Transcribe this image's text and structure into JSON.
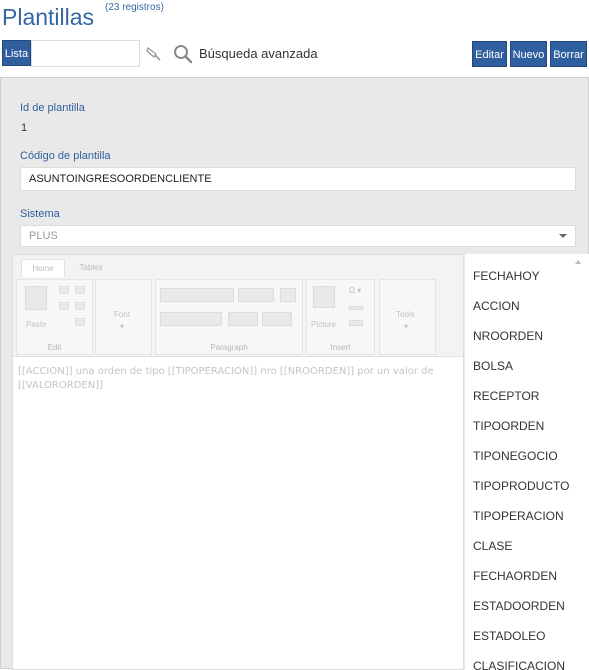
{
  "header": {
    "title": "Plantillas",
    "count": "(23 registros)"
  },
  "toolbar": {
    "list_label": "Lista",
    "search_value": "",
    "advanced_search": "Búsqueda avanzada",
    "edit_label": "Editar",
    "new_label": "Nuevo",
    "delete_label": "Borrar"
  },
  "form": {
    "id_label": "Id de plantilla",
    "id_value": "1",
    "code_label": "Código de plantilla",
    "code_value": "ASUNTOINGRESOORDENCLIENTE",
    "system_label": "Sistema",
    "system_value": "PLUS"
  },
  "editor": {
    "tabs": [
      "Home",
      "Tables"
    ],
    "groups": {
      "edit": "Edit",
      "paste": "Paste",
      "font": "Font",
      "paragraph": "Paragraph",
      "insert": "Insert",
      "picture": "Picture",
      "tools": "Tools"
    },
    "content": "[[ACCION]] una orden de tipo [[TIPOPERACION]] nro [[NROORDEN]] por un valor de [[VALORORDEN]]"
  },
  "variables": [
    "FECHAHOY",
    "ACCION",
    "NROORDEN",
    "BOLSA",
    "RECEPTOR",
    "TIPOORDEN",
    "TIPONEGOCIO",
    "TIPOPRODUCTO",
    "TIPOPERACION",
    "CLASE",
    "FECHAORDEN",
    "ESTADOORDEN",
    "ESTADOLEO",
    "CLASIFICACION"
  ],
  "colors": {
    "accent": "#2f5f9e",
    "title": "#3567a5"
  }
}
